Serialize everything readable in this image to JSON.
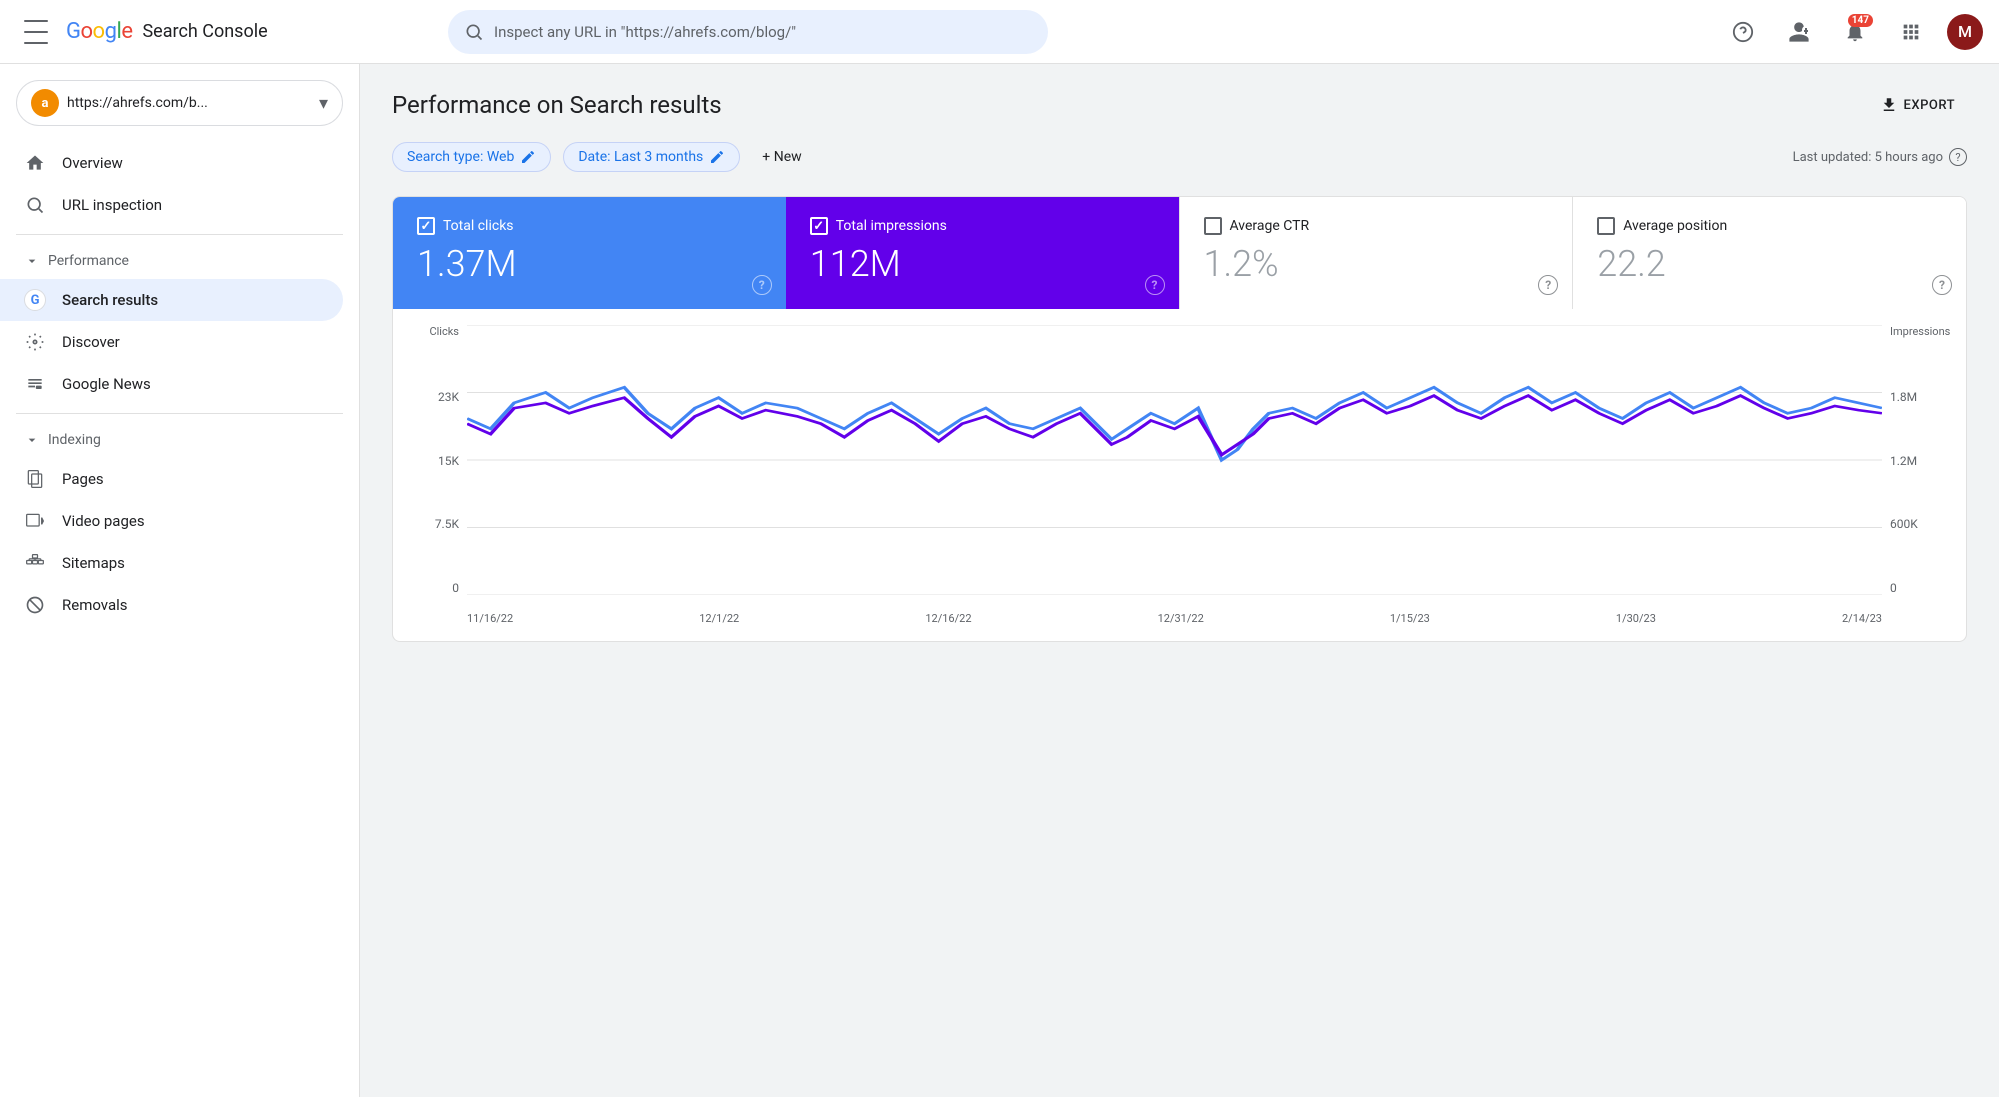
{
  "topbar": {
    "menu_icon": "hamburger",
    "logo_text": "Google",
    "app_name": "Search Console",
    "search_placeholder": "Inspect any URL in \"https://ahrefs.com/blog/\"",
    "help_icon": "help-circle",
    "users_icon": "manage-accounts",
    "notifications_icon": "bell",
    "notifications_count": "147",
    "apps_icon": "grid",
    "avatar_letter": "M"
  },
  "sidebar": {
    "property": {
      "icon": "a",
      "url": "https://ahrefs.com/b...",
      "dropdown_icon": "▾"
    },
    "nav": [
      {
        "id": "overview",
        "label": "Overview",
        "icon": "home"
      },
      {
        "id": "url-inspection",
        "label": "URL inspection",
        "icon": "search"
      }
    ],
    "sections": [
      {
        "id": "performance",
        "label": "Performance",
        "expanded": true,
        "items": [
          {
            "id": "search-results",
            "label": "Search results",
            "icon": "google-g",
            "active": true
          },
          {
            "id": "discover",
            "label": "Discover",
            "icon": "asterisk"
          },
          {
            "id": "google-news",
            "label": "Google News",
            "icon": "news-grid"
          }
        ]
      },
      {
        "id": "indexing",
        "label": "Indexing",
        "expanded": true,
        "items": [
          {
            "id": "pages",
            "label": "Pages",
            "icon": "pages"
          },
          {
            "id": "video-pages",
            "label": "Video pages",
            "icon": "video"
          },
          {
            "id": "sitemaps",
            "label": "Sitemaps",
            "icon": "sitemaps"
          },
          {
            "id": "removals",
            "label": "Removals",
            "icon": "removals"
          }
        ]
      }
    ]
  },
  "main": {
    "page_title": "Performance on Search results",
    "export_label": "EXPORT",
    "filters": {
      "search_type": "Search type: Web",
      "date": "Date: Last 3 months",
      "new_label": "+ New",
      "last_updated": "Last updated: 5 hours ago"
    },
    "metrics": [
      {
        "id": "total-clicks",
        "label": "Total clicks",
        "value": "1.37M",
        "active": true,
        "color": "blue",
        "checked": true
      },
      {
        "id": "total-impressions",
        "label": "Total impressions",
        "value": "112M",
        "active": true,
        "color": "purple",
        "checked": true
      },
      {
        "id": "average-ctr",
        "label": "Average CTR",
        "value": "1.2%",
        "active": false,
        "checked": false
      },
      {
        "id": "average-position",
        "label": "Average position",
        "value": "22.2",
        "active": false,
        "checked": false
      }
    ],
    "chart": {
      "y_left_label": "Clicks",
      "y_right_label": "Impressions",
      "y_left_values": [
        "23K",
        "15K",
        "7.5K",
        "0"
      ],
      "y_right_values": [
        "1.8M",
        "1.2M",
        "600K",
        "0"
      ],
      "x_labels": [
        "11/16/22",
        "12/1/22",
        "12/16/22",
        "12/31/22",
        "1/15/23",
        "1/30/23",
        "2/14/23"
      ]
    }
  }
}
